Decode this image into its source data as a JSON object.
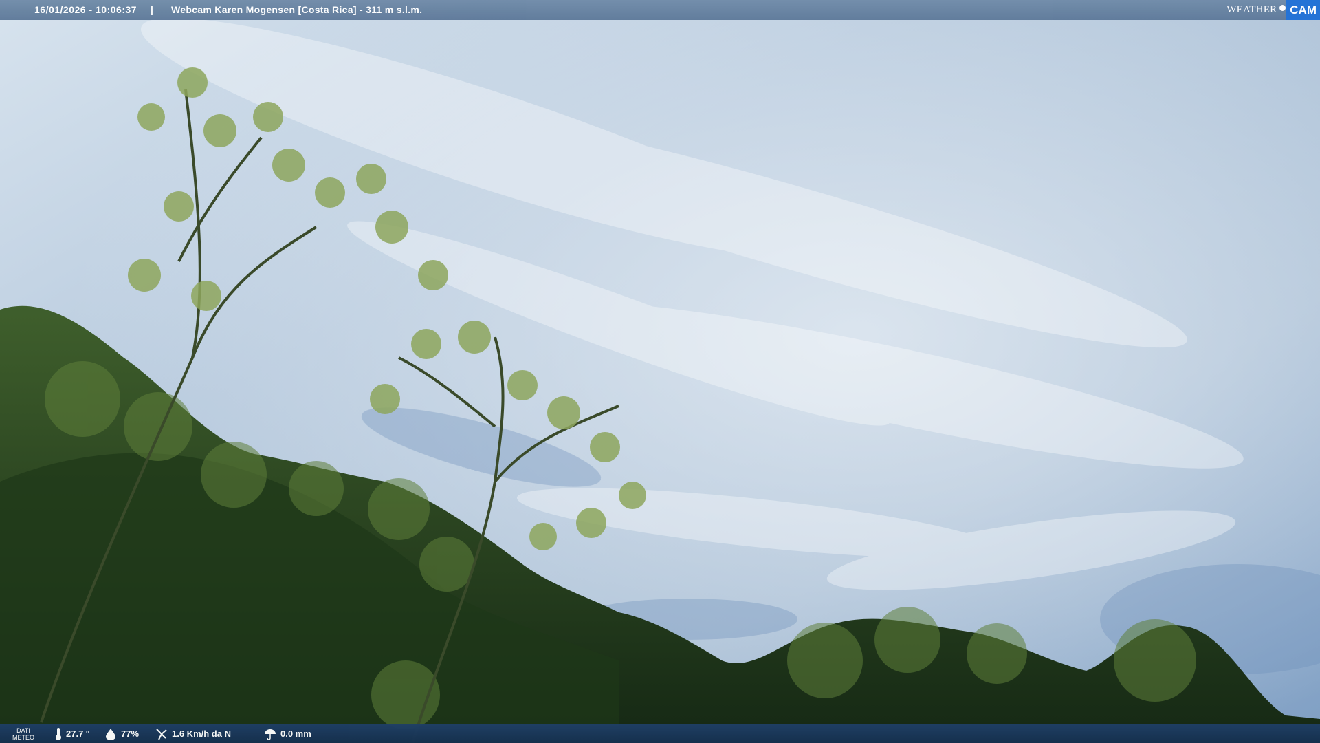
{
  "header": {
    "timestamp": "16/01/2026 - 10:06:37",
    "separator": "|",
    "camera_title": "Webcam Karen Mogensen [Costa Rica] - 311 m s.l.m."
  },
  "logo": {
    "weather": "WEATHER",
    "cam": "CAM"
  },
  "weather_bar": {
    "label_line1": "DATI",
    "label_line2": "METEO",
    "temperature": "27.7 °",
    "humidity": "77%",
    "wind": "1.6 Km/h da N",
    "rain": "0.0 mm"
  },
  "icons": {
    "temperature": "thermometer-icon",
    "humidity": "humidity-drop-icon",
    "wind": "wind-vane-icon",
    "rain": "rain-umbrella-icon"
  }
}
